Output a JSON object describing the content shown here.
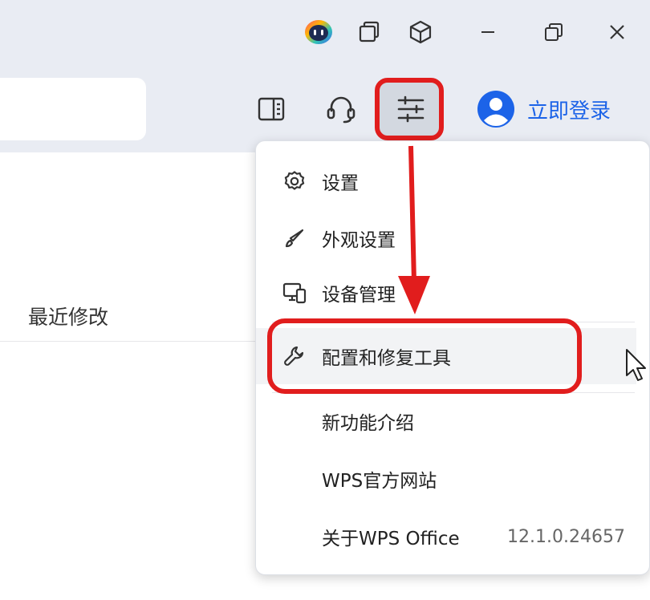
{
  "header": {
    "login_label": "立即登录"
  },
  "icons": {
    "assistant": "ai-assistant-icon",
    "window": "window-icon",
    "cube": "cube-icon",
    "minimize": "minimize-icon",
    "restore": "restore-icon",
    "close": "close-icon",
    "panel": "side-panel-icon",
    "support": "headset-icon",
    "settings": "sliders-icon",
    "avatar": "user-avatar-icon"
  },
  "list": {
    "column_recent": "最近修改"
  },
  "menu": {
    "items": [
      {
        "label": "设置",
        "icon": "gear-icon"
      },
      {
        "label": "外观设置",
        "icon": "brush-icon"
      },
      {
        "label": "设备管理",
        "icon": "devices-icon"
      },
      {
        "label": "配置和修复工具",
        "icon": "wrench-icon"
      },
      {
        "label": "新功能介绍"
      },
      {
        "label": "WPS官方网站"
      },
      {
        "label": "关于WPS Office",
        "version": "12.1.0.24657"
      }
    ]
  },
  "colors": {
    "accent": "#1c63e8",
    "highlight": "#e11d1d",
    "titlebar_bg": "#e9ecf3"
  }
}
